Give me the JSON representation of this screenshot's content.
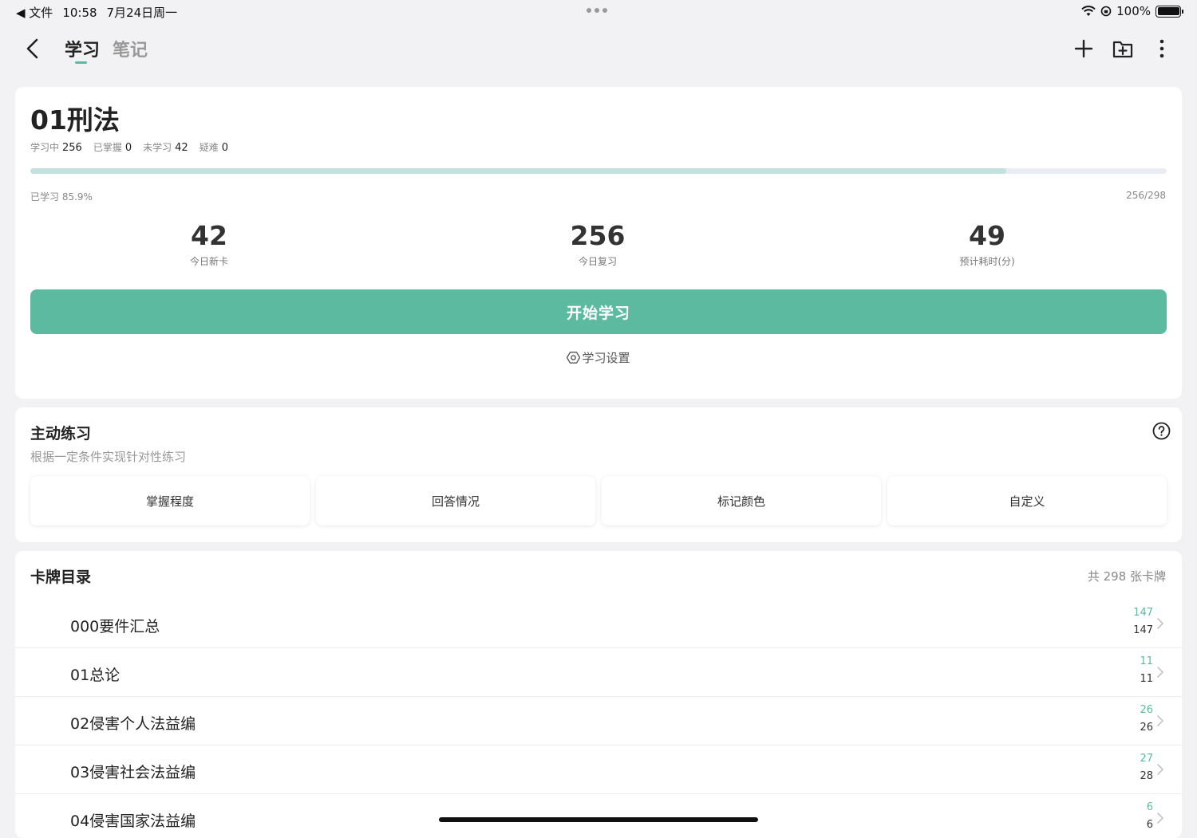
{
  "status_bar": {
    "back_app": "◀ 文件",
    "time": "10:58",
    "date": "7月24日周一",
    "battery": "100%"
  },
  "nav": {
    "tabs": [
      {
        "label": "学习",
        "active": true
      },
      {
        "label": "笔记",
        "active": false
      }
    ]
  },
  "deck": {
    "title": "01刑法",
    "stats": [
      {
        "label": "学习中",
        "value": "256"
      },
      {
        "label": "已掌握",
        "value": "0"
      },
      {
        "label": "未学习",
        "value": "42"
      },
      {
        "label": "疑难",
        "value": "0"
      }
    ],
    "progress_fraction": 0.859,
    "progress_label": "已学习 85.9%",
    "progress_count": "256/298",
    "metrics": [
      {
        "value": "42",
        "label": "今日新卡"
      },
      {
        "value": "256",
        "label": "今日复习"
      },
      {
        "value": "49",
        "label": "预计耗时(分)"
      }
    ],
    "start_label": "开始学习",
    "settings_label": "学习设置"
  },
  "practice": {
    "title": "主动练习",
    "subtitle": "根据一定条件实现针对性练习",
    "filters": [
      "掌握程度",
      "回答情况",
      "标记颜色",
      "自定义"
    ]
  },
  "catalog": {
    "title": "卡牌目录",
    "total": "共 298 张卡牌",
    "items": [
      {
        "name": "000要件汇总",
        "count_a": "147",
        "count_b": "147"
      },
      {
        "name": "01总论",
        "count_a": "11",
        "count_b": "11"
      },
      {
        "name": "02侵害个人法益编",
        "count_a": "26",
        "count_b": "26"
      },
      {
        "name": "03侵害社会法益编",
        "count_a": "27",
        "count_b": "28"
      },
      {
        "name": "04侵害国家法益编",
        "count_a": "6",
        "count_b": "6"
      }
    ]
  },
  "colors": {
    "accent": "#5cbaa0",
    "progress": "#c2e3dd",
    "background": "#f2f2f4"
  }
}
